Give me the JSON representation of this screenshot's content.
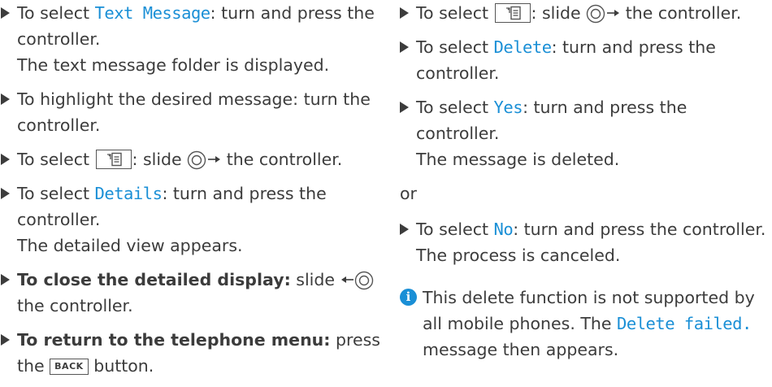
{
  "left": {
    "i1": {
      "a": "To select ",
      "hl": "Text Message",
      "b": ": turn and press the controller.",
      "note": "The text message folder is displayed."
    },
    "i2": {
      "a": "To highlight the desired message: turn the controller."
    },
    "i3": {
      "a": "To select ",
      "b": ": slide ",
      "c": " the controller."
    },
    "i4": {
      "a": "To select ",
      "hl": "Details",
      "b": ": turn and press the controller.",
      "note": "The detailed view appears."
    },
    "i5": {
      "bold": "To close the detailed display:",
      "a": " slide ",
      "b": " the controller."
    },
    "i6": {
      "bold": "To return to the telephone menu:",
      "a": " press the ",
      "key": "BACK",
      "b": " button."
    }
  },
  "right": {
    "i1": {
      "a": "To select ",
      "b": ": slide ",
      "c": " the controller."
    },
    "i2": {
      "a": "To select ",
      "hl": "Delete",
      "b": ": turn and press the controller."
    },
    "i3": {
      "a": "To select ",
      "hl": "Yes",
      "b": ": turn and press the controller.",
      "note": "The message is deleted."
    },
    "or": "or",
    "i4": {
      "a": "To select ",
      "hl": "No",
      "b": ": turn and press the controller.",
      "note": "The process is canceled."
    },
    "info": {
      "icon": "i",
      "a": "This delete function is not supported by all mobile phones. The ",
      "hl": "Delete failed.",
      "b": " message then appears."
    }
  },
  "icons": {
    "bullet": "triangle-right-icon",
    "menu": "message-menu-icon",
    "controller": "controller-icon"
  },
  "colors": {
    "text": "#3c3c3c",
    "highlight": "#1a8fd6"
  }
}
